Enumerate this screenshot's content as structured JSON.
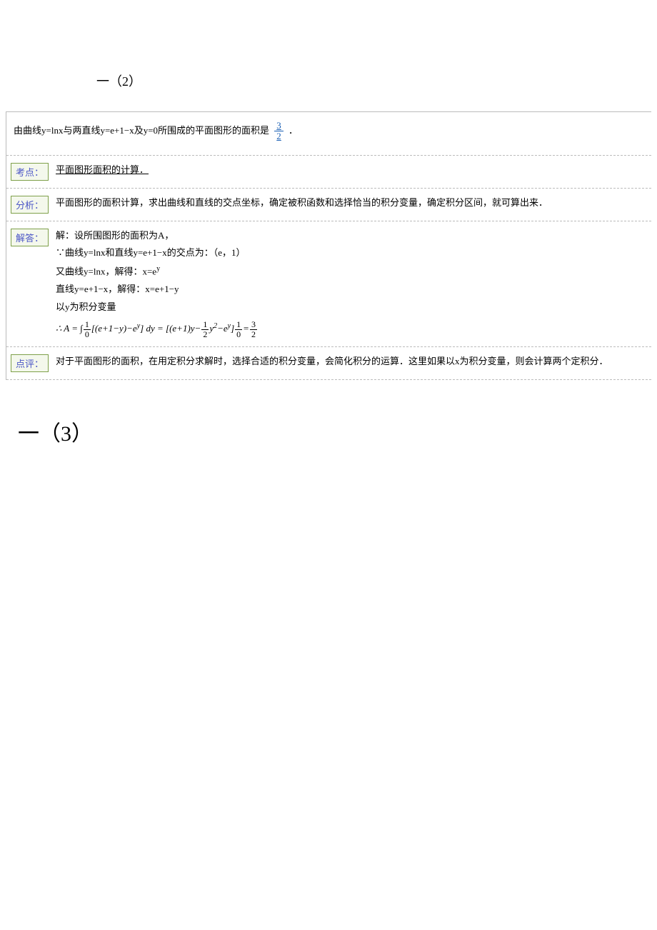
{
  "heading1": "一（2）",
  "heading2": "一（3）",
  "question": {
    "pre": "由曲线y=lnx与两直线y=e+1−x及y=0所围成的平面图形的面积是",
    "frac_num": "3",
    "frac_den": "2",
    "post": "．"
  },
  "rows": {
    "kaodian": {
      "label": "考点：",
      "text": "平面图形面积的计算．"
    },
    "fenxi": {
      "label": "分析：",
      "text": "平面图形的面积计算，求出曲线和直线的交点坐标，确定被积函数和选择恰当的积分变量，确定积分区间，就可算出来．"
    },
    "jieda": {
      "label": "解答：",
      "line1": "解：设所围图形的面积为A，",
      "line2": "∵曲线y=lnx和直线y=e+1−x的交点为：（e，1）",
      "line3_pre": "又曲线y=lnx，解得：x=e",
      "line3_sup": "y",
      "line4": "直线y=e+1−x，解得：x=e+1−y",
      "line5": "以y为积分变量",
      "formula": {
        "lead": "∴ A = ∫",
        "int_top": "1",
        "int_bot": "0",
        "body1": "[(e+1−y)−e",
        "body1_sup": "y",
        "body2": "] dy = [(e+1)y−",
        "f1_num": "1",
        "f1_den": "2",
        "body3": "y",
        "body3_sup": "2",
        "body4": "−e",
        "body4_sup": "y",
        "body5": "]",
        "lim_top": "1",
        "lim_bot": "0",
        "eq": "=",
        "f2_num": "3",
        "f2_den": "2"
      }
    },
    "dianping": {
      "label": "点评：",
      "text": "对于平面图形的面积，在用定积分求解时，选择合适的积分变量，会简化积分的运算．这里如果以x为积分变量，则会计算两个定积分．"
    }
  }
}
